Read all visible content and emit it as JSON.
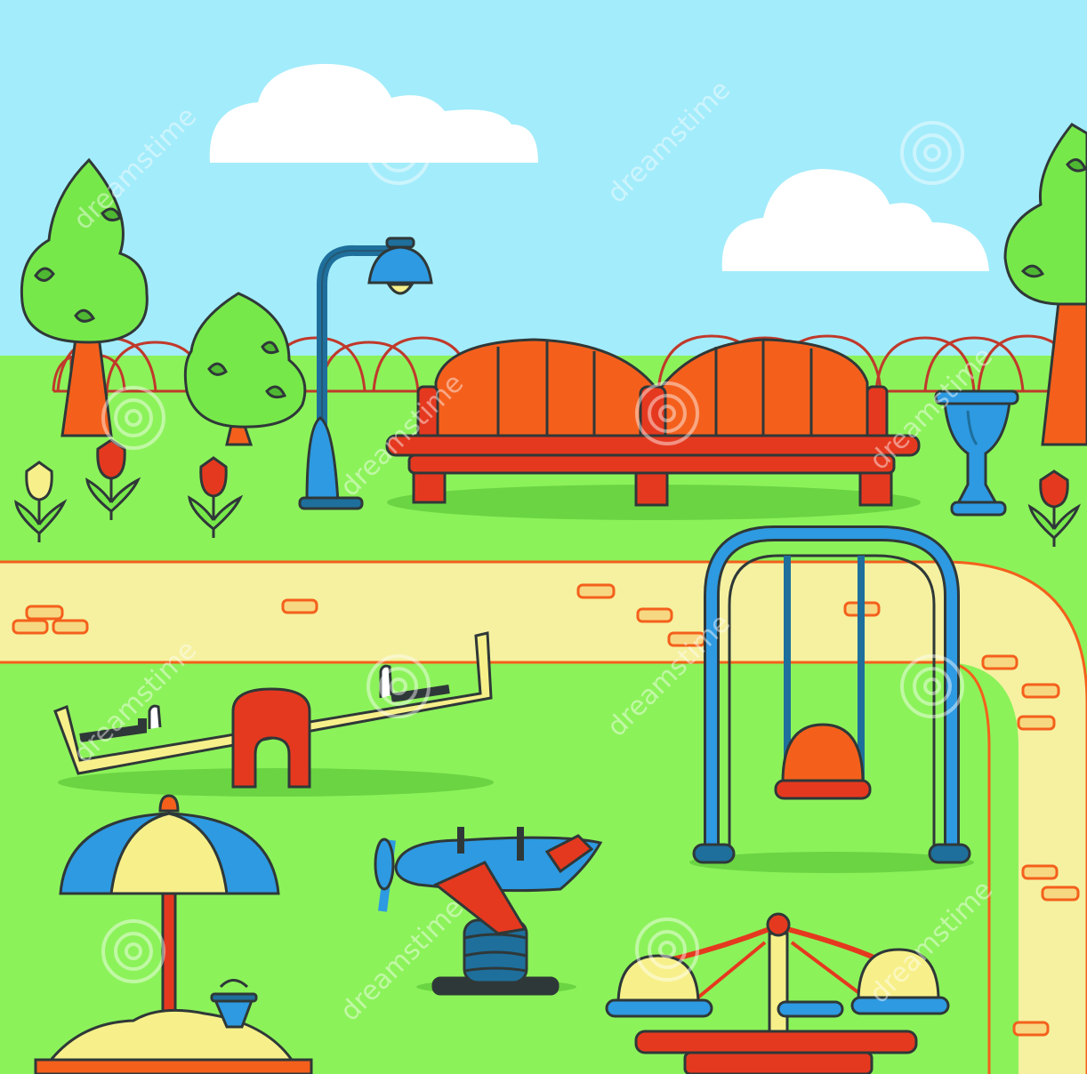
{
  "scene": {
    "colors": {
      "sky": "#a3ecfb",
      "grass": "#8cf25a",
      "path": "#f5f1a0",
      "outline": "#2f3838",
      "red": "#e5391f",
      "orange": "#f4601c",
      "blue": "#2d9ae2",
      "navy": "#1e6f9c",
      "yellow": "#f7f08a",
      "tree_green": "#77e84a",
      "brick": "#f7d882"
    },
    "watermark": {
      "text": "dreamstime"
    }
  }
}
